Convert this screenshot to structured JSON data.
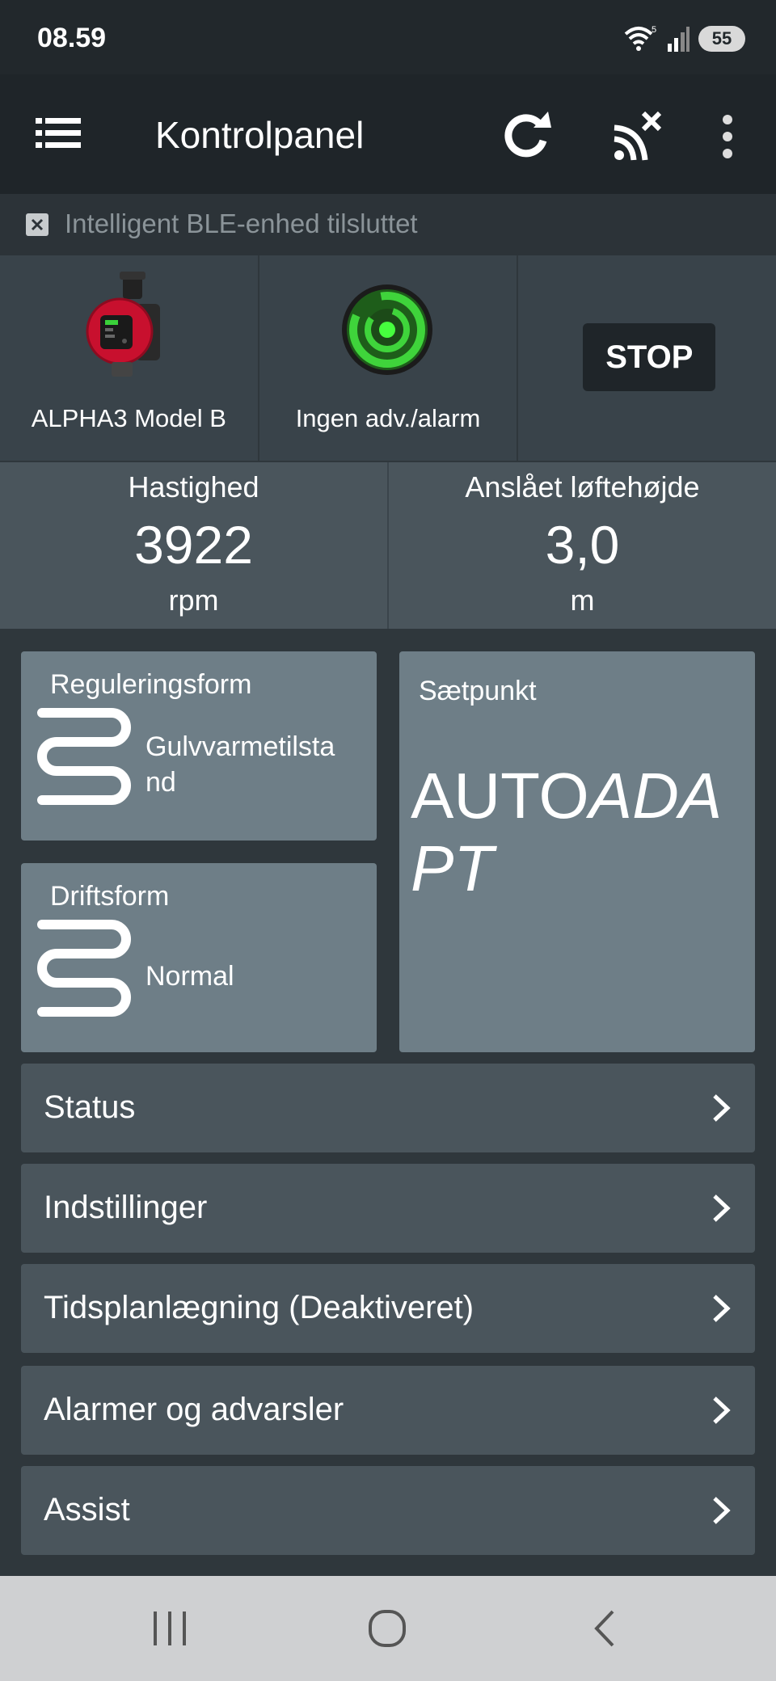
{
  "status_bar": {
    "time": "08.59",
    "battery": "55"
  },
  "app_bar": {
    "title": "Kontrolpanel"
  },
  "connection_banner": {
    "text": "Intelligent BLE-enhed tilsluttet"
  },
  "device": {
    "model": "ALPHA3 Model B",
    "alarm_status": "Ingen adv./alarm",
    "stop_label": "STOP"
  },
  "metrics": [
    {
      "label": "Hastighed",
      "value": "3922",
      "unit": "rpm"
    },
    {
      "label": "Anslået løftehøjde",
      "value": "3,0",
      "unit": "m"
    }
  ],
  "tiles": {
    "control_mode": {
      "label": "Reguleringsform",
      "value": "Gulvvarmetilstand",
      "value_line1": "Gulvvarmetilsta",
      "value_line2": "nd"
    },
    "operating_mode": {
      "label": "Driftsform",
      "value": "Normal"
    },
    "setpoint": {
      "label": "Sætpunkt",
      "value_normal": "AUTO",
      "value_italic": "ADAPT"
    }
  },
  "nav_items": [
    {
      "label": "Status"
    },
    {
      "label": "Indstillinger"
    },
    {
      "label": "Tidsplanlægning (Deaktiveret)"
    },
    {
      "label": "Alarmer og advarsler"
    },
    {
      "label": "Assist"
    }
  ],
  "colors": {
    "background": "#2f373c",
    "app_bar": "#1f2529",
    "tile": "#6e7e87",
    "nav_row": "#4a555c",
    "status_ok_green": "#3fd43b"
  }
}
